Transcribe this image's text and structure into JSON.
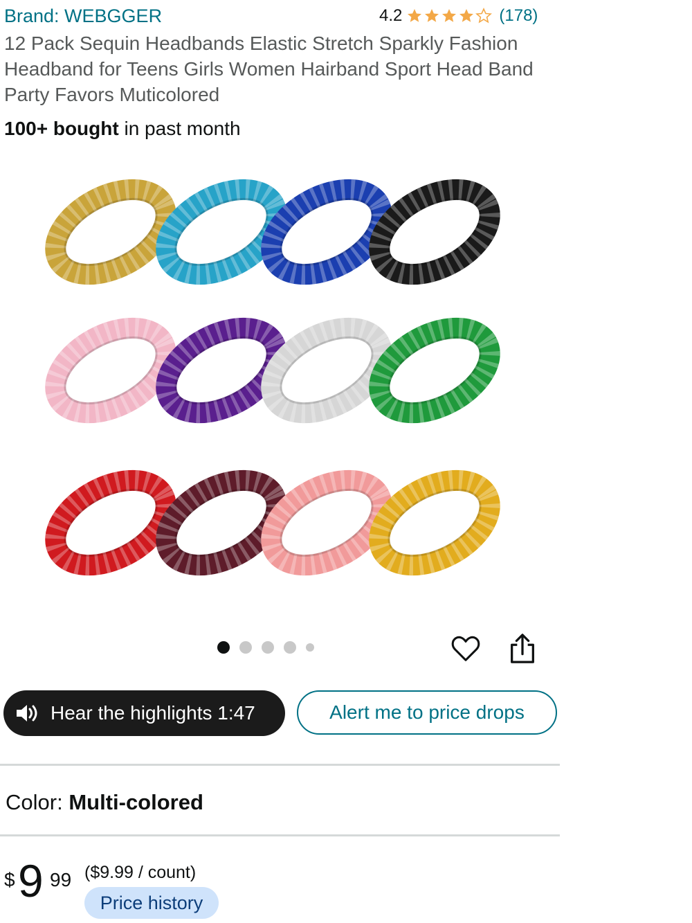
{
  "brand": "Brand: WEBGGER",
  "rating": {
    "value": "4.2",
    "stars": 4.2,
    "count": "(178)",
    "star_color": "#f3a847"
  },
  "title": "12 Pack Sequin Headbands Elastic Stretch Sparkly Fashion Headband for Teens Girls Women Hairband Sport Head Band Party Favors Muticolored",
  "bought": {
    "bold": "100+ bought",
    "rest": " in past month"
  },
  "gallery": {
    "current_index": 1,
    "total_dots": 5,
    "headbands": [
      {
        "color": "#c9a43a"
      },
      {
        "color": "#27a3c8"
      },
      {
        "color": "#1b3fb0"
      },
      {
        "color": "#1a1a1a"
      },
      {
        "color": "#f2b6c6"
      },
      {
        "color": "#5a1f8e"
      },
      {
        "color": "#d6d6d6"
      },
      {
        "color": "#1f9a3c"
      },
      {
        "color": "#d01a1f"
      },
      {
        "color": "#5e1c2a"
      },
      {
        "color": "#f19a9a"
      },
      {
        "color": "#e2ac1e"
      }
    ]
  },
  "actions": {
    "heart_icon": "heart-icon",
    "share_icon": "share-icon"
  },
  "hear": {
    "label": "Hear the highlights 1:47"
  },
  "alert": {
    "label": "Alert me to price drops"
  },
  "color": {
    "label": "Color: ",
    "value": "Multi-colored"
  },
  "price": {
    "symbol": "$",
    "whole": "9",
    "fraction": "99",
    "unit": "($9.99 / count)"
  },
  "price_history": {
    "label": "Price history"
  },
  "colors": {
    "link": "#007185",
    "pill": "#cfe3fb",
    "dark_button": "#1b1b1b"
  }
}
